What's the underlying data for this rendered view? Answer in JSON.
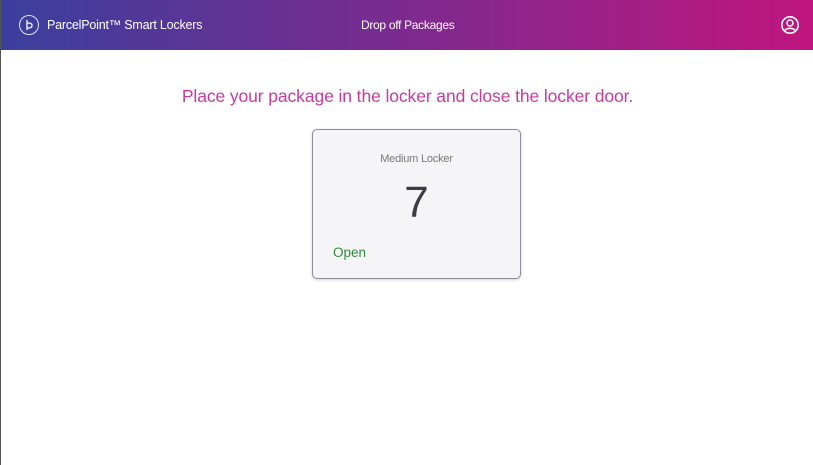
{
  "colors": {
    "header_gradient_start": "#3a3f9e",
    "header_gradient_end": "#c0157e",
    "accent_magenta": "#c83aa0",
    "status_green": "#2e8b3e"
  },
  "header": {
    "logo_icon": "parcelpoint-logo-icon",
    "brand": "ParcelPoint™ Smart Lockers",
    "title": "Drop off Packages",
    "account_icon": "user-account-icon"
  },
  "main": {
    "instruction": "Place your package in the locker and close the locker door.",
    "locker": {
      "size": "Medium Locker",
      "number": "7",
      "status": "Open"
    }
  }
}
